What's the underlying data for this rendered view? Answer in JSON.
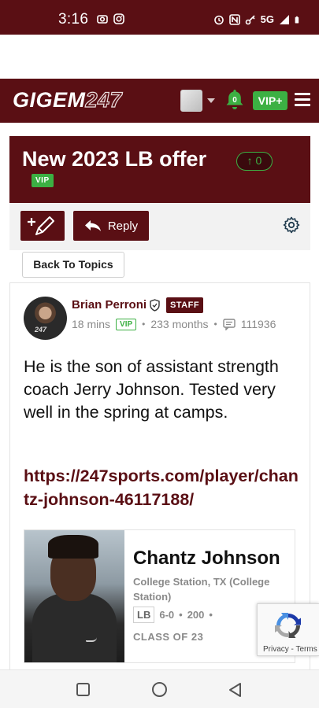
{
  "status_bar": {
    "time": "3:16",
    "icons_left": [
      "photo-camera-icon",
      "instagram-icon"
    ],
    "icons_right": [
      "alarm-icon",
      "nfc-icon",
      "key-icon",
      "5g-signal-icon",
      "battery-icon"
    ],
    "network_label": "5G"
  },
  "header": {
    "logo_main": "GIGEM",
    "logo_num": "247",
    "notification_count": "0",
    "vip_label": "VIP+",
    "colors": {
      "brand": "#5a0f14",
      "accent_green": "#3cb043"
    }
  },
  "thread": {
    "title": "New 2023 LB offer",
    "vote_count": "0",
    "vote_arrow": "↑",
    "vip_tag": "VIP"
  },
  "actions": {
    "reply_label": "Reply",
    "back_label": "Back To Topics"
  },
  "post": {
    "author_name": "Brian Perroni",
    "author_badge": "STAFF",
    "avatar_text": "247",
    "time_ago": "18 mins",
    "vip_tag": "VIP",
    "tenure": "233 months",
    "post_count": "111936",
    "body": "He is the son of assistant strength coach Jerry Johnson. Tested very well in the spring at camps.",
    "link": "https://247sports.com/player/chantz-johnson-46117188/"
  },
  "player_card": {
    "name": "Chantz Johnson",
    "location": "College Station, TX (College Station)",
    "position": "LB",
    "height": "6-0",
    "weight": "200",
    "class_label": "CLASS OF 23"
  },
  "recaptcha": {
    "links": "Privacy - Terms"
  }
}
